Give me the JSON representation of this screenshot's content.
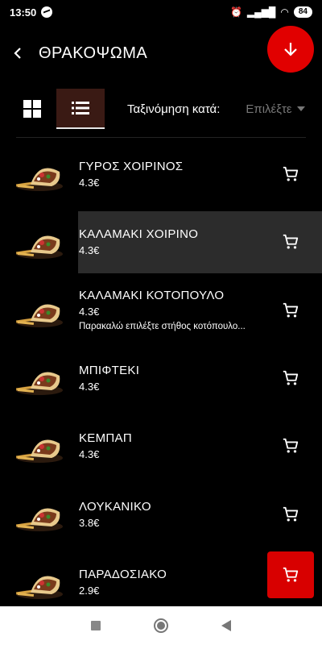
{
  "status_bar": {
    "time": "13:50",
    "battery": "84",
    "icons": [
      "messenger-icon",
      "alarm-icon",
      "signal-icon",
      "wifi-icon",
      "battery-icon"
    ]
  },
  "header": {
    "title": "ΘΡΑΚΟΨΩΜΑ",
    "back_icon": "chevron-left-icon",
    "download_icon": "arrow-down-icon"
  },
  "toolbar": {
    "sort_label": "Ταξινόμηση κατά:",
    "sort_value": "Επιλέξτε",
    "grid_icon": "grid-icon",
    "list_icon": "list-icon"
  },
  "products": [
    {
      "name": "ΓΥΡΟΣ ΧΟΙΡΙΝΟΣ",
      "price": "4.3€",
      "note": "",
      "active": false
    },
    {
      "name": "ΚΑΛΑΜΑΚΙ ΧΟΙΡΙΝΟ",
      "price": "4.3€",
      "note": "",
      "active": true
    },
    {
      "name": "ΚΑΛΑΜΑΚΙ ΚΟΤΟΠΟΥΛΟ",
      "price": "4.3€",
      "note": "Παρακαλώ επιλέξτε στήθος κοτόπουλο...",
      "active": false
    },
    {
      "name": "ΜΠΙΦΤΕΚΙ",
      "price": "4.3€",
      "note": "",
      "active": false
    },
    {
      "name": "ΚΕΜΠΑΠ",
      "price": "4.3€",
      "note": "",
      "active": false
    },
    {
      "name": "ΛΟΥΚΑΝΙΚΟ",
      "price": "3.8€",
      "note": "",
      "active": false
    },
    {
      "name": "ΠΑΡΑΔΟΣΙΑΚΟ",
      "price": "2.9€",
      "note": "",
      "active": false
    }
  ],
  "colors": {
    "accent": "#e10000",
    "background": "#000000",
    "active_row": "#2c2c2c",
    "list_toggle_bg": "#3a1a14"
  }
}
